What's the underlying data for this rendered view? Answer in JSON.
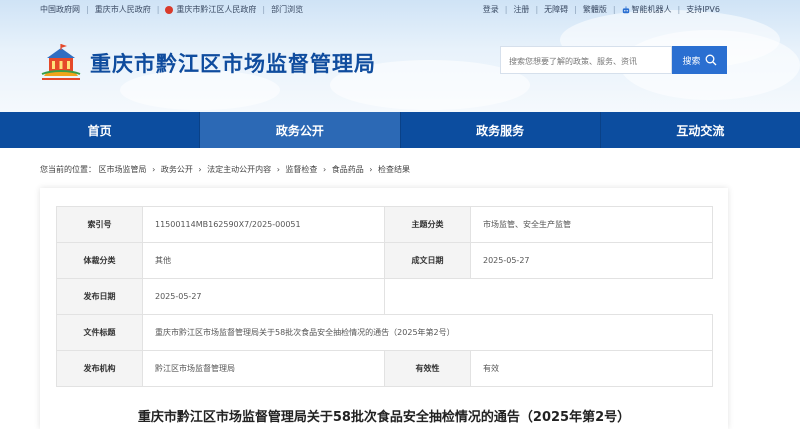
{
  "topbar": {
    "left_links": [
      "中国政府网",
      "重庆市人民政府",
      "重庆市黔江区人民政府",
      "部门浏览"
    ],
    "right_links": [
      "登录",
      "注册",
      "无障碍",
      "繁體版",
      "智能机器人",
      "支持IPV6"
    ]
  },
  "header": {
    "site_title": "重庆市黔江区市场监督管理局",
    "search_placeholder": "搜索您想要了解的政策、服务、资讯",
    "search_button": "搜索"
  },
  "nav": {
    "items": [
      "首页",
      "政务公开",
      "政务服务",
      "互动交流"
    ],
    "active_index": 1
  },
  "breadcrumb": {
    "prefix": "您当前的位置：",
    "items": [
      "区市场监管局",
      "政务公开",
      "法定主动公开内容",
      "监督检查",
      "食品药品",
      "检查结果"
    ]
  },
  "meta": {
    "index_label": "索引号",
    "index_value": "11500114MB162590X7/2025-00051",
    "topic_label": "主题分类",
    "topic_value": "市场监管、安全生产监管",
    "genre_label": "体裁分类",
    "genre_value": "其他",
    "created_label": "成文日期",
    "created_value": "2025-05-27",
    "published_label": "发布日期",
    "published_value": "2025-05-27",
    "doctitle_label": "文件标题",
    "doctitle_value": "重庆市黔江区市场监督管理局关于58批次食品安全抽检情况的通告（2025年第2号）",
    "org_label": "发布机构",
    "org_value": "黔江区市场监督管理局",
    "validity_label": "有效性",
    "validity_value": "有效"
  },
  "article": {
    "title": "重庆市黔江区市场监督管理局关于58批次食品安全抽检情况的通告（2025年第2号）"
  },
  "colors": {
    "nav_bg": "#0c4d9f",
    "nav_active": "#2c69b5",
    "title_blue": "#0f4c9e",
    "search_button": "#2a6fd1"
  }
}
